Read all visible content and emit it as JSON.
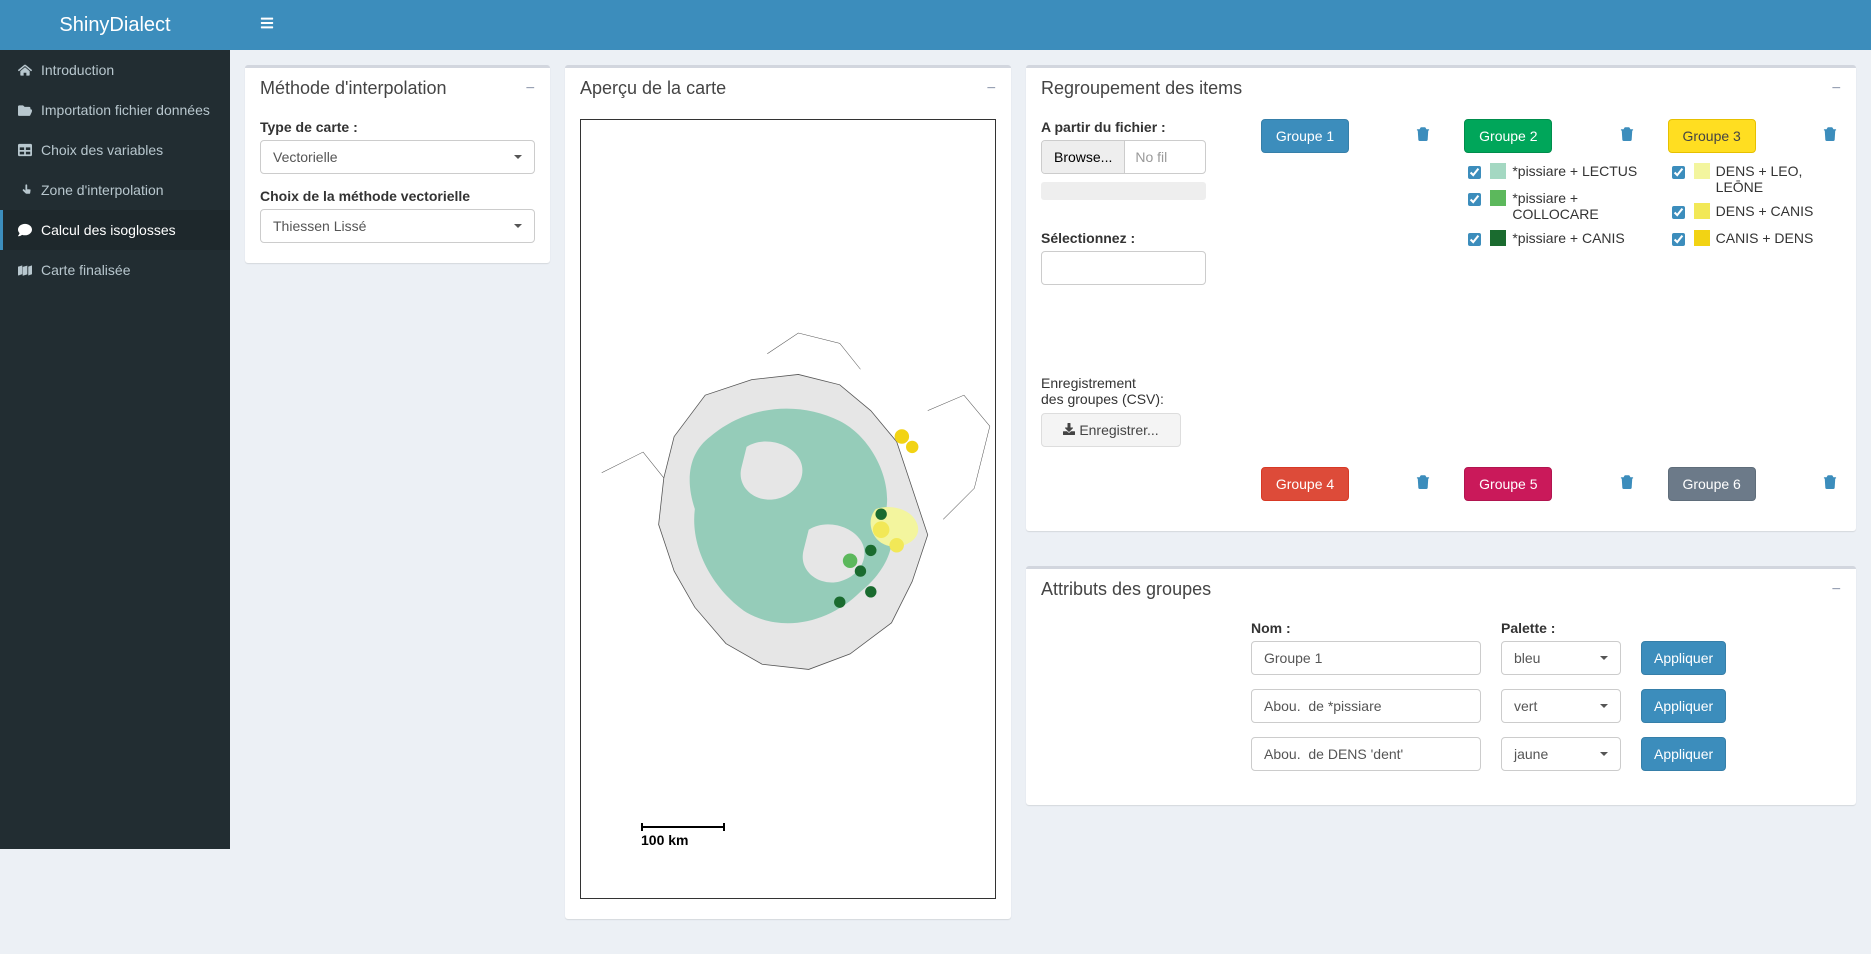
{
  "app_title": "ShinyDialect",
  "sidebar": {
    "items": [
      {
        "icon": "home",
        "label": "Introduction"
      },
      {
        "icon": "folder-open",
        "label": "Importation fichier données"
      },
      {
        "icon": "table",
        "label": "Choix des variables"
      },
      {
        "icon": "hand-pointer",
        "label": "Zone d'interpolation"
      },
      {
        "icon": "comment",
        "label": "Calcul des isoglosses",
        "active": true
      },
      {
        "icon": "map",
        "label": "Carte finalisée"
      }
    ]
  },
  "interp_box": {
    "title": "Méthode d'interpolation",
    "type_label": "Type de carte :",
    "type_value": "Vectorielle",
    "vec_label": "Choix de la méthode vectorielle",
    "vec_value": "Thiessen Lissé"
  },
  "map_box": {
    "title": "Aperçu de la carte",
    "scale_label": "100 km"
  },
  "regroup": {
    "title": "Regroupement des items",
    "from_file_label": "A partir du fichier :",
    "browse_label": "Browse...",
    "file_status": "No fil",
    "select_label": "Sélectionnez :",
    "save_section_label_1": "Enregistrement",
    "save_section_label_2": "des groupes (CSV):",
    "save_button": "Enregistrer...",
    "groups": [
      {
        "id": 1,
        "label": "Groupe 1",
        "color_class": "btn-primary",
        "items": []
      },
      {
        "id": 2,
        "label": "Groupe 2",
        "color_class": "btn-green",
        "items": [
          {
            "swatch": "#a4d8c2",
            "text": "*pissiare + LECTUS",
            "checked": true
          },
          {
            "swatch": "#5cb85c",
            "text": "*pissiare + COLLOCARE",
            "checked": true
          },
          {
            "swatch": "#1a6b2f",
            "text": "*pissiare + CANIS",
            "checked": true
          }
        ]
      },
      {
        "id": 3,
        "label": "Groupe 3",
        "color_class": "btn-yellow2",
        "items": [
          {
            "swatch": "#f3f59e",
            "text": "DENS + LEO, LEŌNE",
            "checked": true
          },
          {
            "swatch": "#f2e857",
            "text": "DENS + CANIS",
            "checked": true
          },
          {
            "swatch": "#f2d314",
            "text": "CANIS + DENS",
            "checked": true
          }
        ]
      },
      {
        "id": 4,
        "label": "Groupe 4",
        "color_class": "btn-red",
        "items": []
      },
      {
        "id": 5,
        "label": "Groupe 5",
        "color_class": "btn-magenta",
        "items": []
      },
      {
        "id": 6,
        "label": "Groupe 6",
        "color_class": "btn-slate",
        "items": []
      }
    ]
  },
  "attrs": {
    "title": "Attributs des groupes",
    "nom_label": "Nom :",
    "palette_label": "Palette :",
    "apply_label": "Appliquer",
    "rows": [
      {
        "nom": "Groupe 1",
        "palette": "bleu"
      },
      {
        "nom": "Abou.  de *pissiare",
        "palette": "vert"
      },
      {
        "nom": "Abou.  de DENS 'dent'",
        "palette": "jaune"
      }
    ]
  }
}
